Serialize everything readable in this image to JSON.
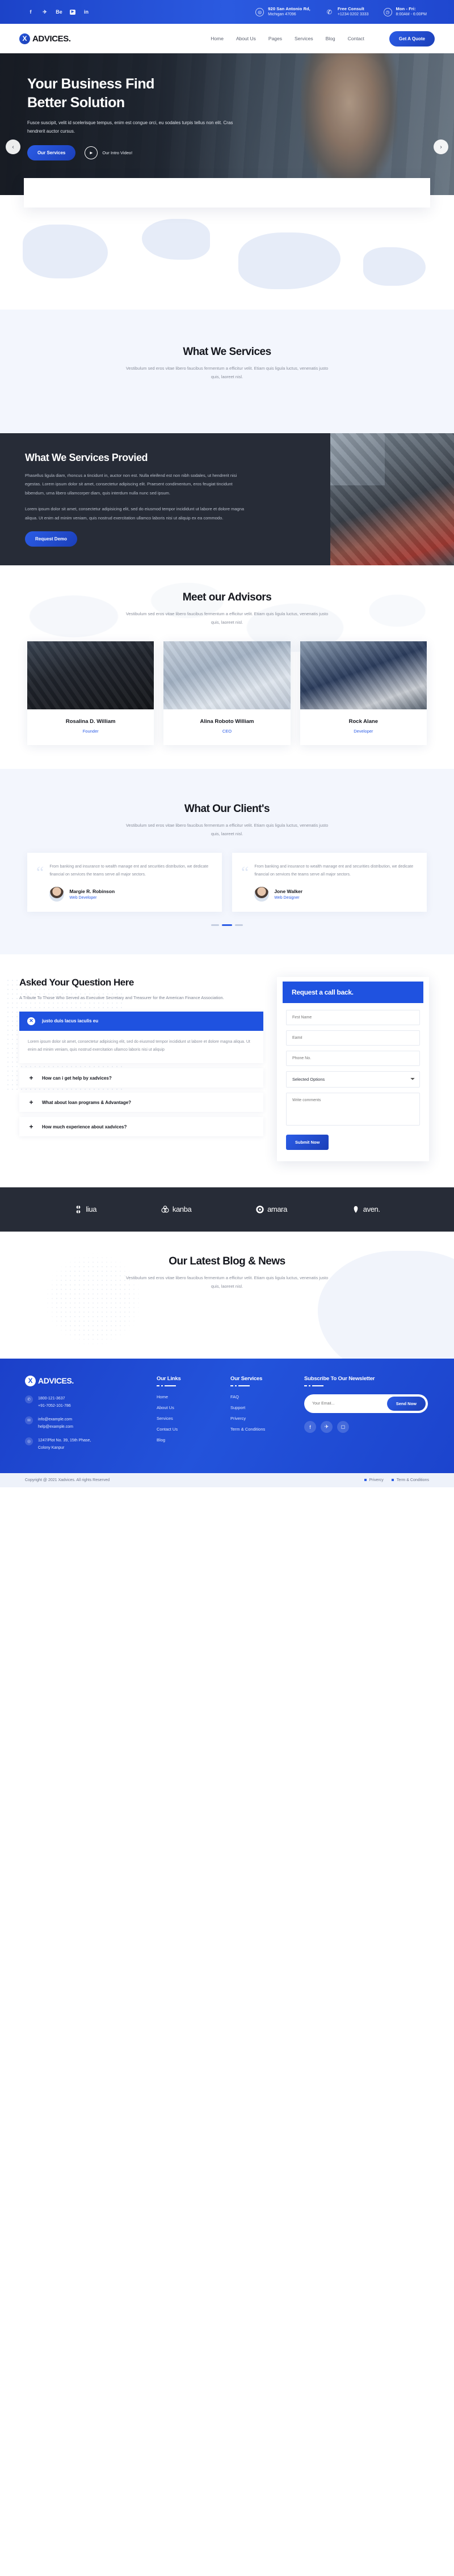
{
  "topbar": {
    "social": [
      {
        "name": "facebook-icon",
        "glyph": "f"
      },
      {
        "name": "twitter-icon",
        "glyph": "✈"
      },
      {
        "name": "behance-icon",
        "glyph": "Be"
      },
      {
        "name": "youtube-icon",
        "glyph": "▶"
      },
      {
        "name": "linkedin-icon",
        "glyph": "in"
      }
    ],
    "info": [
      {
        "icon": "location-icon",
        "glyph": "◎",
        "line1": "920 San Antonio Rd,",
        "line2": "Michigan 47096"
      },
      {
        "icon": "phone-icon",
        "glyph": "✆",
        "line1": "Free Consult",
        "line2": "+1234 0202 3333"
      },
      {
        "icon": "clock-icon",
        "glyph": "◷",
        "line1": "Mon - Fri:",
        "line2": "8:00AM - 6:00PM"
      }
    ]
  },
  "nav": {
    "logo_letter": "X",
    "brand": "ADVICES.",
    "items": [
      "Home",
      "About Us",
      "Pages",
      "Services",
      "Blog",
      "Contact"
    ],
    "cta": "Get A Quote"
  },
  "hero": {
    "title_line1": "Your Business Find",
    "title_line2": "Better Solution",
    "subtitle": "Fusce suscipit, velit id scelerisque tempus, enim est congue orci, eu sodales turpis tellus non elit. Cras hendrerit auctor cursus.",
    "primary_cta": "Our Services",
    "video_label": "Our Intro Video!",
    "prev": "‹",
    "next": "›"
  },
  "services": {
    "title": "What We Services",
    "subtitle": "Vestibulum sed eros vitae libero faucibus fermentum a efficitur velit. Etiam quis ligula luctus, venenatis justo quis, laoreet nisl."
  },
  "provided": {
    "title": "What We Services Provied",
    "para1": "Phasellus ligula diam, rhoncus a tincidunt in, auctor non est. Nulla eleifend est non nibh sodales, ut hendrerit nisi egestas. Lorem ipsum dolor sit amet, consectetur adipiscing elit. Praesent condimentum, eros feugiat tincidunt bibendum, urna libero ullamcorper diam, quis interdum nulla nunc sed ipsum.",
    "para2": "Lorem ipsum dolor sit amet, consectetur adipisicing elit, sed do eiusmod tempor incididunt ut labore et dolore magna aliqua. Ut enim ad minim veniam, quis nostrud exercitation ullamco laboris nisi ut aliquip ex ea commodo.",
    "cta": "Request Demo"
  },
  "team": {
    "title": "Meet our Advisors",
    "subtitle": "Vestibulum sed eros vitae libero faucibus fermentum a efficitur velit. Etiam quis ligula luctus, venenatis justo quis, laoreet nisl.",
    "members": [
      {
        "name": "Rosalina D. William",
        "role": "Founder"
      },
      {
        "name": "Alina Roboto William",
        "role": "CEO"
      },
      {
        "name": "Rock Alane",
        "role": "Developer"
      }
    ]
  },
  "testimonials": {
    "title": "What Our Client's",
    "subtitle": "Vestibulum sed eros vitae libero faucibus fermentum a efficitur velit. Etiam quis ligula luctus, venenatis justo quis, laoreet nisl.",
    "items": [
      {
        "quote": "From banking and insurance to wealth manage ent and securities distribution, we dedicate financial on services the teams serve all major sectors.",
        "name": "Margie R. Robinson",
        "role": "Web Developer"
      },
      {
        "quote": "From banking and insurance to wealth manage ent and securities distribution, we dedicate financial on services the teams serve all major sectors.",
        "name": "Jone Walker",
        "role": "Web Designer"
      }
    ]
  },
  "faq": {
    "title": "Asked Your Question Here",
    "lead": "A Tribute To Those Who Served as Executive Secretary and Treasurer for the American Finance Association.",
    "items": [
      {
        "question": "justo duis lacus iaculis eu",
        "marker": "✕",
        "open": true,
        "answer": "Lorem ipsum dolor sit amet, consectetur adipisicing elit, sed do eiusmod tempor incididunt ut labore et dolore magna aliqua. Ut enim ad minim veniam, quis nostrud exercitation ullamco laboris nisi ut aliquip"
      },
      {
        "question": "How can i get help by xadvices?",
        "marker": "+",
        "open": false,
        "answer": ""
      },
      {
        "question": "What about loan programs & Advantage?",
        "marker": "+",
        "open": false,
        "answer": ""
      },
      {
        "question": "How much experience about xadvices?",
        "marker": "+",
        "open": false,
        "answer": ""
      }
    ]
  },
  "callback": {
    "title": "Request a call back.",
    "fields": {
      "first_name_placeholder": "First Name",
      "email_placeholder": "Eamil",
      "phone_placeholder": "Phone No.",
      "select_value": "Selected Options",
      "comments_placeholder": "Write comments"
    },
    "submit": "Submit Now"
  },
  "brands": [
    {
      "name": "liua",
      "icon": "clover-icon"
    },
    {
      "name": "kanba",
      "icon": "rings-icon"
    },
    {
      "name": "amara",
      "icon": "target-icon"
    },
    {
      "name": "aven.",
      "icon": "leaf-icon"
    }
  ],
  "blog": {
    "title": "Our Latest Blog & News",
    "subtitle": "Vestibulum sed eros vitae libero faucibus fermentum a efficitur velit. Etiam quis ligula luctus, venenatis justo quis, laoreet nisl."
  },
  "footer": {
    "logo_letter": "X",
    "brand": "ADVICES.",
    "contacts": [
      {
        "icon": "phone-icon",
        "glyph": "✆",
        "lines": [
          "1800-121-3637",
          "+91-7052-101-786"
        ]
      },
      {
        "icon": "mail-icon",
        "glyph": "✉",
        "lines": [
          "info@example.com",
          "help@example.com"
        ]
      },
      {
        "icon": "location-icon",
        "glyph": "◎",
        "lines": [
          "1247/Plot No. 39, 15th Phase,",
          "Colony Kanpur"
        ]
      }
    ],
    "links_col": {
      "title": "Our Links",
      "items": [
        "Home",
        "About Us",
        "Services",
        "Contact Us",
        "Blog"
      ]
    },
    "services_col": {
      "title": "Our Services",
      "items": [
        "FAQ",
        "Support",
        "Privercy",
        "Term & Conditions"
      ]
    },
    "newsletter": {
      "title": "Subscribe To Our Newsletter",
      "placeholder": "Your Email...",
      "button": "Send Now",
      "social": [
        {
          "name": "facebook-icon",
          "glyph": "f"
        },
        {
          "name": "twitter-icon",
          "glyph": "✈"
        },
        {
          "name": "instagram-icon",
          "glyph": "◻"
        }
      ]
    }
  },
  "copyright": {
    "text": "Copyright @ 2021 Xadvices. All rights Reserved",
    "links": [
      "Privercy",
      "Term & Conditions"
    ]
  },
  "colors": {
    "brand_blue": "#1f52e0",
    "dark": "#272c37",
    "light_bg": "#f3f6fd"
  }
}
